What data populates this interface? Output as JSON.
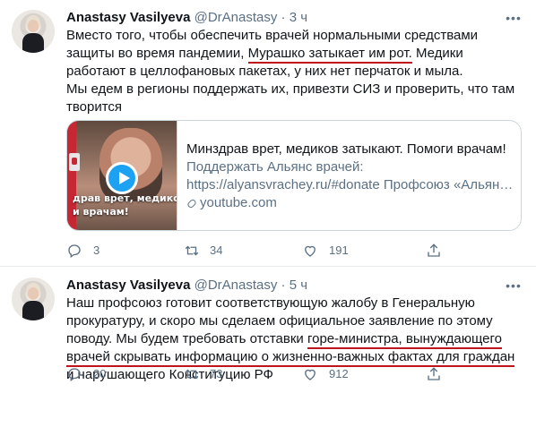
{
  "tweets": [
    {
      "author": {
        "name": "Anastasy Vasilyeva",
        "handle": "@DrAnastasy",
        "time": "3 ч"
      },
      "text_lines": [
        {
          "pre": "Вместо того, чтобы обеспечить врачей нормальными средствами",
          "under": "",
          "post": ""
        },
        {
          "pre": "защиты во время пандемии, ",
          "under": "Мурашко  затыкает им рот.",
          "post": " Медики"
        },
        {
          "pre": "работают в целлофановых пакетах, у них нет перчаток и мыла.",
          "under": "",
          "post": ""
        },
        {
          "pre": "Мы едем в регионы поддержать их, привезти СИЗ и проверить, что там",
          "under": "",
          "post": ""
        },
        {
          "pre": "творится",
          "under": "",
          "post": ""
        }
      ],
      "card": {
        "thumb_caption_line1": "драв врет, медиков заты",
        "thumb_caption_line2": "и врачам!",
        "title": "Минздрав врет, медиков затыкают. Помоги врачам!",
        "desc_line1": "Поддержать Альянс врачей:",
        "desc_line2": "https://alyansvrachey.ru/#donate Профсоюз «Альян…",
        "domain": "youtube.com"
      },
      "stats": {
        "replies": "3",
        "retweets": "34",
        "likes": "191"
      }
    },
    {
      "author": {
        "name": "Anastasy Vasilyeva",
        "handle": "@DrAnastasy",
        "time": "5 ч"
      },
      "text_lines": [
        {
          "pre": "Наш профсоюз готовит соответствующую жалобу в Генеральную",
          "under": "",
          "post": ""
        },
        {
          "pre": "прокуратуру, и скоро мы сделаем официальное заявление по этому",
          "under": "",
          "post": ""
        },
        {
          "pre": "поводу. Мы будем требовать отставки ",
          "under": "горе-министра, вынуждающего",
          "post": ""
        },
        {
          "pre": "",
          "under": "врачей скрывать информацию о жизненно-важных фактах для граждан",
          "post": ""
        },
        {
          "pre": "и нарушающего Конституцию РФ",
          "under": "",
          "post": ""
        }
      ],
      "stats": {
        "replies": "20",
        "retweets": "73",
        "likes": "912"
      }
    }
  ],
  "icons": {
    "more": "more-icon",
    "reply": "reply-icon",
    "retweet": "retweet-icon",
    "like": "like-icon",
    "share": "share-icon",
    "play": "play-icon",
    "link": "link-icon"
  },
  "colors": {
    "text": "#0f1419",
    "secondary": "#5b7083",
    "underline": "#c0141c",
    "accent": "#1da1f2",
    "border": "#e6ecf0"
  }
}
